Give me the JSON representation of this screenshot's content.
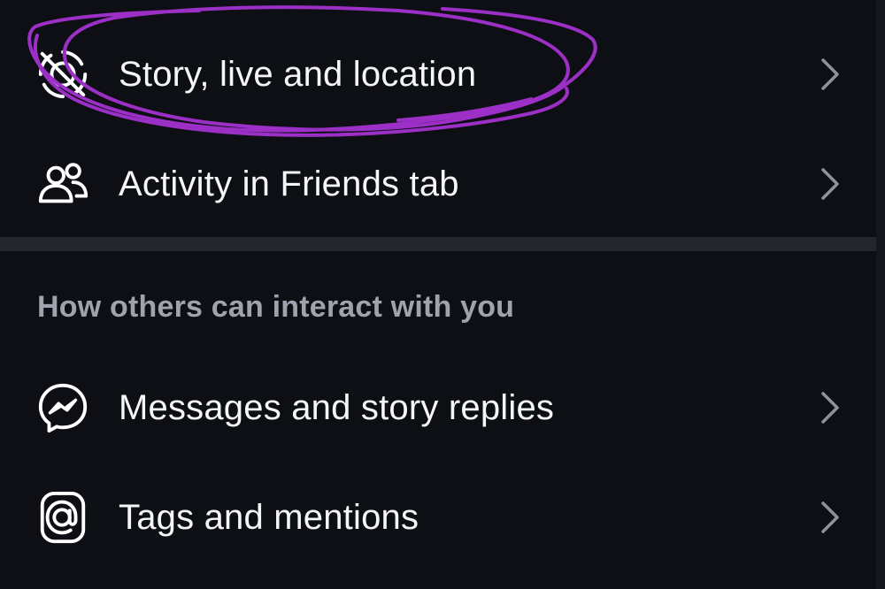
{
  "rows_top": [
    {
      "label": "Story, live and location",
      "icon": "story-location-off-icon"
    },
    {
      "label": "Activity in Friends tab",
      "icon": "friends-icon"
    }
  ],
  "section": {
    "header": "How others can interact with you"
  },
  "rows_bottom": [
    {
      "label": "Messages and story replies",
      "icon": "messenger-icon"
    },
    {
      "label": "Tags and mentions",
      "icon": "at-sign-icon"
    }
  ],
  "colors": {
    "background": "#0d0f14",
    "divider": "#24262b",
    "text": "#f5f6f8",
    "muted_text": "#9ea3ad",
    "chevron": "#8e929a",
    "annotation_stroke": "#9b2fc6"
  }
}
